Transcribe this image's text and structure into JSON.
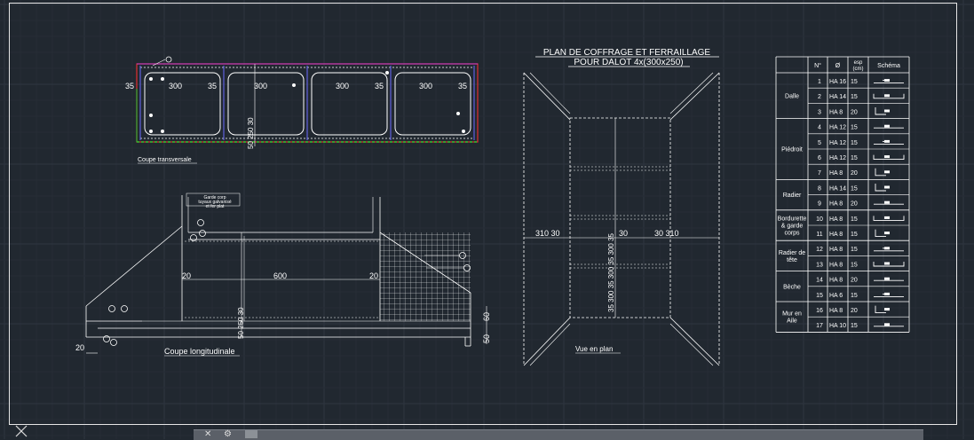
{
  "title": {
    "line1": "PLAN DE COFFRAGE ET FERRAILLAGE",
    "line2": "POUR DALOT 4x(300x250)"
  },
  "transversal": {
    "caption": "Coupe transversale",
    "dims": [
      "35",
      "300",
      "35",
      "300",
      "300",
      "35",
      "300",
      "35"
    ],
    "vertical_dim": "50 250 30"
  },
  "longitudinal": {
    "caption": "Coupe longitudinale",
    "note": [
      "Garde corp",
      "tuyaux galvanisé",
      "et fer plat"
    ],
    "dims": {
      "left": "20",
      "middle": "600",
      "right": "20"
    },
    "vertical_dim": "50 250 30",
    "right_dims": [
      "60",
      "50"
    ],
    "left_bottom_dim": "20"
  },
  "plan": {
    "caption": "Vue en plan",
    "left_dim": "310 30",
    "right_dim": "30 310",
    "vertical_dim": "35 300 35 300 35 300 35",
    "mid_dim": "30"
  },
  "rebar_table": {
    "headers": {
      "num": "N°",
      "diam": "Ø",
      "esp": "esp\n(cm)",
      "schema": "Schéma"
    },
    "groups": [
      {
        "name": "Dalle",
        "rows": [
          [
            "1",
            "HA 16",
            "15"
          ],
          [
            "2",
            "HA 14",
            "15"
          ],
          [
            "3",
            "HA 8",
            "20"
          ]
        ]
      },
      {
        "name": "Piédroit",
        "rows": [
          [
            "4",
            "HA 12",
            "15"
          ],
          [
            "5",
            "HA 12",
            "15"
          ],
          [
            "6",
            "HA 12",
            "15"
          ],
          [
            "7",
            "HA 8",
            "20"
          ]
        ]
      },
      {
        "name": "Radier",
        "rows": [
          [
            "8",
            "HA 14",
            "15"
          ],
          [
            "9",
            "HA 8",
            "20"
          ]
        ]
      },
      {
        "name": "Bordurette\n& garde\ncorps",
        "rows": [
          [
            "10",
            "HA 8",
            "15"
          ],
          [
            "11",
            "HA 8",
            "15"
          ]
        ]
      },
      {
        "name": "Radier de\ntête",
        "rows": [
          [
            "12",
            "HA 8",
            "15"
          ],
          [
            "13",
            "HA 8",
            "15"
          ]
        ]
      },
      {
        "name": "Bèche",
        "rows": [
          [
            "14",
            "HA 8",
            "20"
          ],
          [
            "15",
            "HA 6",
            "15"
          ]
        ]
      },
      {
        "name": "Mur en\nAile",
        "rows": [
          [
            "16",
            "HA 8",
            "20"
          ],
          [
            "17",
            "HA 10",
            "15"
          ]
        ]
      }
    ]
  },
  "commandline": {
    "close_icon": "close-icon",
    "settings_icon": "wrench-icon",
    "prompt_icon": "prompt-icon"
  }
}
